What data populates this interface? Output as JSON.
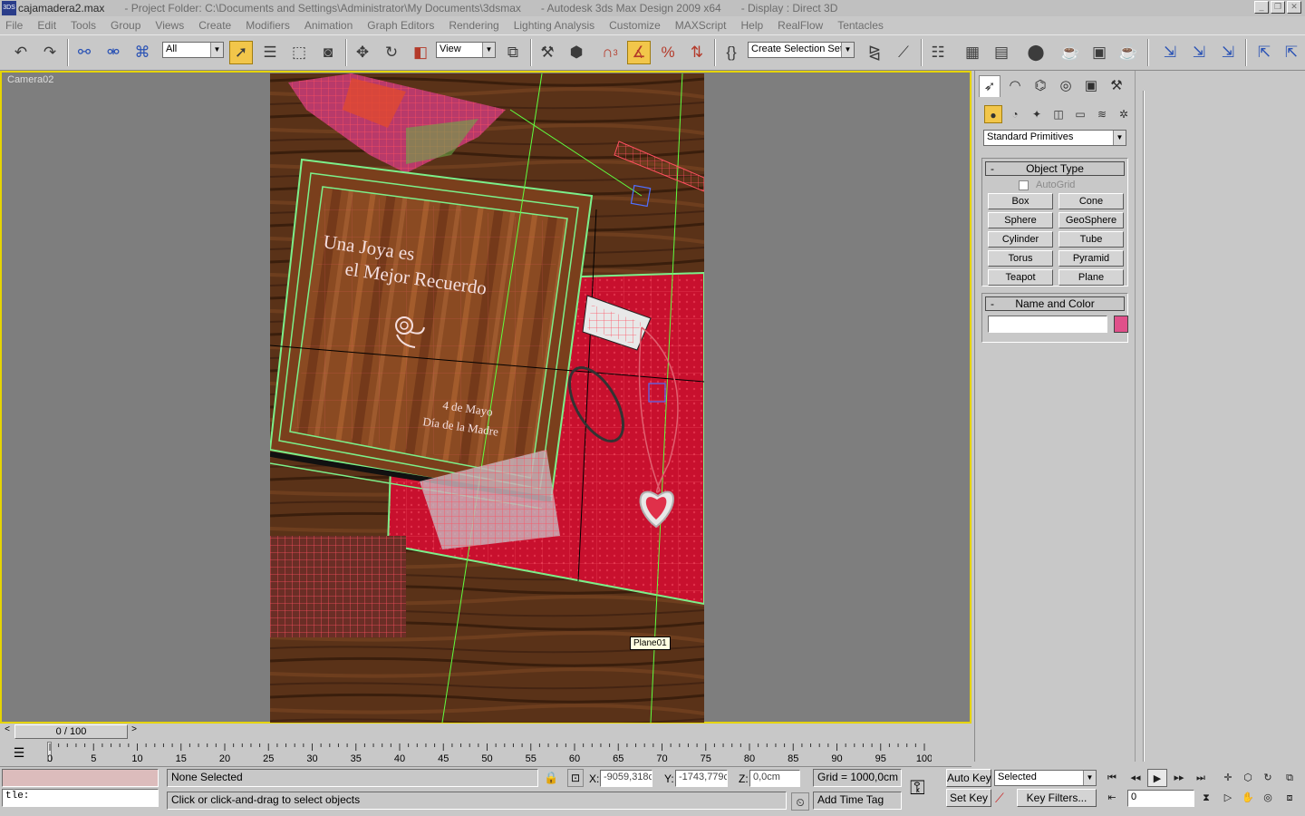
{
  "titlebar": {
    "doc_name": "cajamadera2.max",
    "project_folder": "- Project Folder: C:\\Documents and Settings\\Administrator\\My Documents\\3dsmax",
    "app_name": "- Autodesk 3ds Max Design 2009 x64",
    "display": "- Display : Direct 3D",
    "app_icon_text": "3DS"
  },
  "menu": [
    "File",
    "Edit",
    "Tools",
    "Group",
    "Views",
    "Create",
    "Modifiers",
    "Animation",
    "Graph Editors",
    "Rendering",
    "Lighting Analysis",
    "Customize",
    "MAXScript",
    "Help",
    "RealFlow",
    "Tentacles"
  ],
  "toolbar": {
    "filter_value": "All",
    "refcoord_value": "View",
    "selection_set_placeholder": "Create Selection Set",
    "snap_number": "3"
  },
  "viewport": {
    "label": "Camera02",
    "tooltip": "Plane01",
    "box_lid_text_1": "Una Joya es",
    "box_lid_text_2": "el Mejor Recuerdo",
    "box_lid_text_3": "4 de Mayo",
    "box_lid_text_4": "Día de la Madre"
  },
  "command_panel": {
    "category_dropdown": "Standard Primitives",
    "object_type_title": "Object Type",
    "autogrid_label": "AutoGrid",
    "buttons": [
      "Box",
      "Cone",
      "Sphere",
      "GeoSphere",
      "Cylinder",
      "Tube",
      "Torus",
      "Pyramid",
      "Teapot",
      "Plane"
    ],
    "name_color_title": "Name and Color",
    "name_value": "",
    "object_color": "#e0508a",
    "rollup_minus": "-"
  },
  "trackbar": {
    "time_slider": "0 / 100",
    "prev": "<",
    "next": ">"
  },
  "timeline": {
    "ticks": [
      "0",
      "5",
      "10",
      "15",
      "20",
      "25",
      "30",
      "35",
      "40",
      "45",
      "50",
      "55",
      "60",
      "65",
      "70",
      "75",
      "80",
      "85",
      "90",
      "95",
      "100"
    ]
  },
  "statusbar": {
    "script_input": "tle:",
    "selection_status": "None Selected",
    "prompt": "Click or click-and-drag to select objects",
    "x_label": "X:",
    "x_value": "-9059,318c",
    "y_label": "Y:",
    "y_value": "-1743,779c",
    "z_label": "Z:",
    "z_value": "0,0cm",
    "grid": "Grid = 1000,0cm",
    "add_time_tag": "Add Time Tag",
    "auto_key": "Auto Key",
    "set_key": "Set Key",
    "selected_dropdown": "Selected",
    "key_filters": "Key Filters...",
    "frame_value": "0"
  },
  "colors": {
    "viewport_border": "#e6d400",
    "active_tool": "#f2c64a",
    "wireframe_green": "#7cf08a",
    "cloth_red": "#c8102e"
  }
}
